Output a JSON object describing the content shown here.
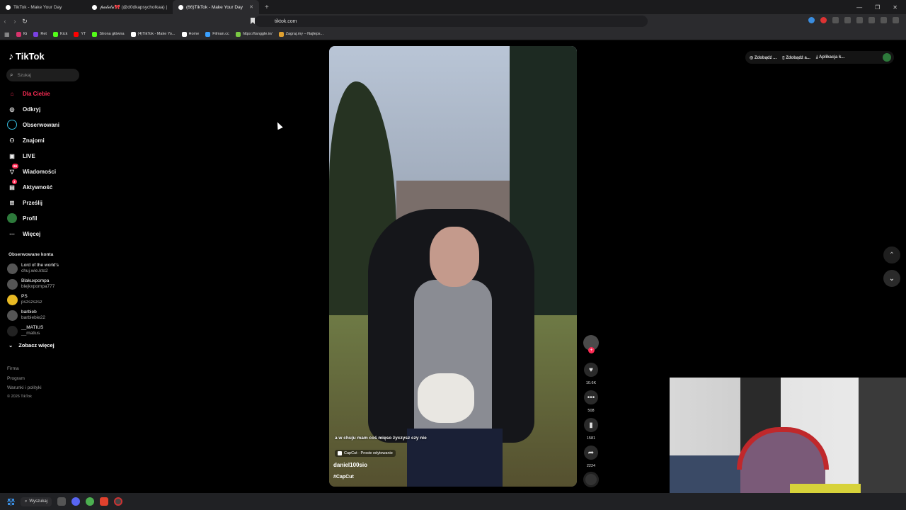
{
  "browser": {
    "tabs": [
      {
        "label": "TikTok - Make Your Day",
        "active": false
      },
      {
        "label": "𝓹𝓾𝓵𝓮𝓽𝓪🎀 (@d0dkapsycholkaa) |",
        "active": false
      },
      {
        "label": "(66)TikTok - Make Your Day",
        "active": true
      }
    ],
    "new_tab": "+",
    "url": "tiktok.com",
    "bookmarks": [
      {
        "label": "IG",
        "color": "#d6336c"
      },
      {
        "label": "Ret",
        "color": "#7b3fe4"
      },
      {
        "label": "Kick",
        "color": "#53fc18"
      },
      {
        "label": "YT",
        "color": "#ff0000"
      },
      {
        "label": "Strona główna",
        "color": "#53fc18"
      },
      {
        "label": "(4)TikTok - Make Yo...",
        "color": "#ffffff"
      },
      {
        "label": "Home",
        "color": "#ffffff"
      },
      {
        "label": "Filman.cc",
        "color": "#3aa0ff"
      },
      {
        "label": "https://tanggle.io/",
        "color": "#7ac943"
      },
      {
        "label": "Zagraj.my – Najleps...",
        "color": "#e0a030"
      }
    ]
  },
  "tiktok": {
    "logo": "TikTok",
    "search_placeholder": "Szukaj",
    "nav": [
      {
        "label": "Dla Ciebie",
        "icon": "home-icon",
        "active": true
      },
      {
        "label": "Odkryj",
        "icon": "compass-icon"
      },
      {
        "label": "Obserwowani",
        "icon": "following-icon"
      },
      {
        "label": "Znajomi",
        "icon": "friends-icon"
      },
      {
        "label": "LIVE",
        "icon": "live-icon"
      },
      {
        "label": "Wiadomości",
        "icon": "messages-icon",
        "badge": "66"
      },
      {
        "label": "Aktywność",
        "icon": "activity-icon",
        "badge": "3"
      },
      {
        "label": "Prześlij",
        "icon": "upload-icon"
      },
      {
        "label": "Profil",
        "icon": "profile-icon"
      },
      {
        "label": "Więcej",
        "icon": "more-icon"
      }
    ],
    "followed_title": "Obserwowane konta",
    "followed": [
      {
        "name": "Lord of the world's",
        "user": "chuj.wie.kto2"
      },
      {
        "name": "Blakuxpompa",
        "user": "blejkxpompa777"
      },
      {
        "name": "PS",
        "user": "pszszszsz"
      },
      {
        "name": "barbieb",
        "user": "barbiebie22"
      },
      {
        "name": "__MATIUS",
        "user": "__matius"
      }
    ],
    "see_more": "Zobacz więcej",
    "footer": [
      "Firma",
      "Program",
      "Warunki i polityki",
      "© 2026 TikTok"
    ],
    "top_actions": [
      "Zdobądź ...",
      "Zdobądź a...",
      "Aplikacja k..."
    ]
  },
  "video": {
    "caption": "a w chuju mam coś mięso życzysz czy nie",
    "capcut": "CapCut · Proste edytowanie",
    "author": "daniel100sio",
    "hashtag": "#CapCut",
    "likes": "10.6K",
    "comments": "508",
    "saves": "1581",
    "shares": "2224"
  },
  "taskbar": {
    "search": "Wyszukaj"
  }
}
